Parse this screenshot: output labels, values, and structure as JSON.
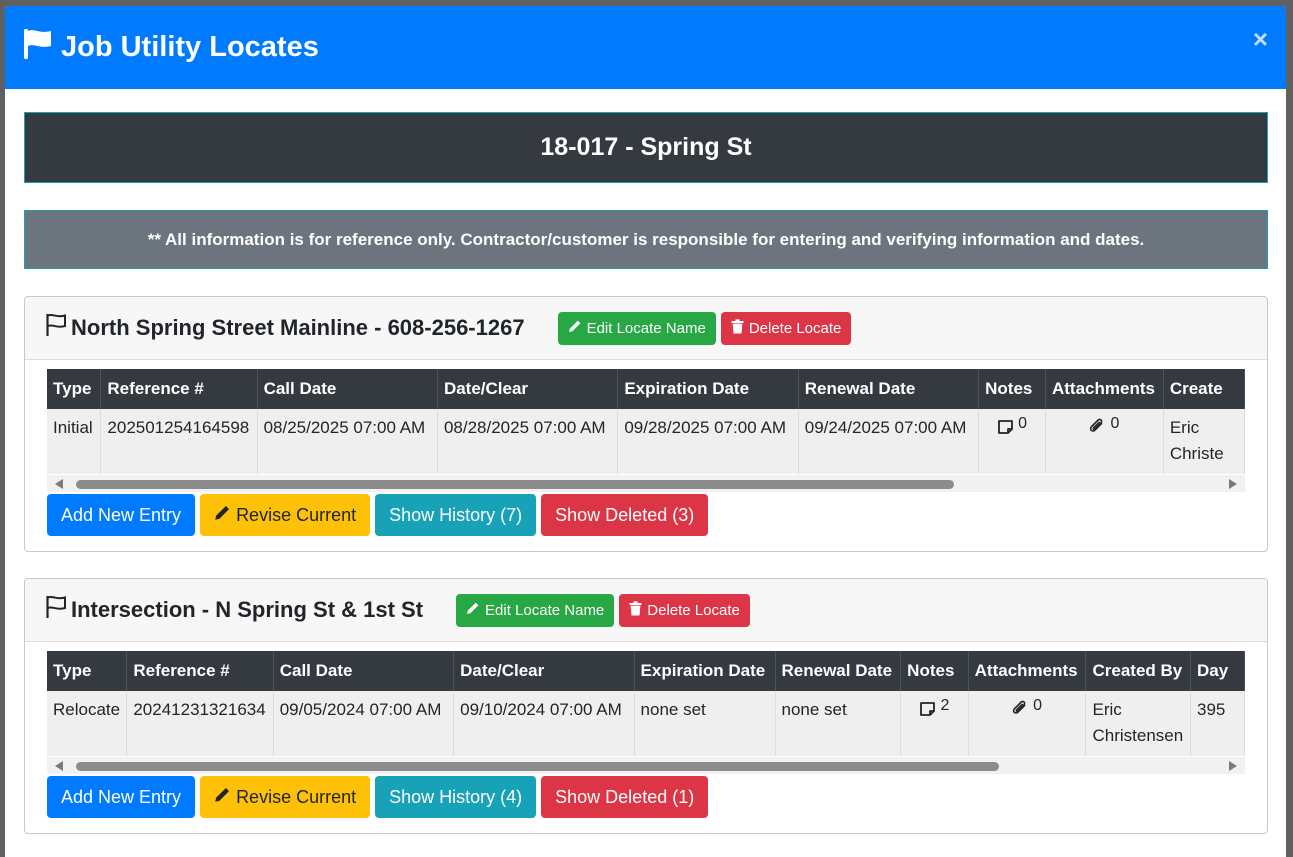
{
  "modal": {
    "title": "Job Utility Locates",
    "close_label": "×"
  },
  "job": {
    "banner": "18-017 - Spring St",
    "notice": "** All information is for reference only. Contractor/customer is responsible for entering and verifying information and dates."
  },
  "locates": [
    {
      "name": "North Spring Street Mainline - 608-256-1267",
      "edit_label": "Edit Locate Name",
      "delete_label": "Delete Locate",
      "headers": [
        "Type",
        "Reference #",
        "Call Date",
        "Date/Clear",
        "Expiration Date",
        "Renewal Date",
        "Notes",
        "Attachments",
        "Create"
      ],
      "row": {
        "type": "Initial",
        "reference": "202501254164598",
        "call_date": "08/25/2025 07:00 AM",
        "date_clear": "08/28/2025 07:00 AM",
        "expiration": "09/28/2025 07:00 AM",
        "renewal": "09/24/2025 07:00 AM",
        "notes_count": "0",
        "attachments_count": "0",
        "created_by": "Eric Christe"
      },
      "scroll_fraction": 0.77,
      "buttons": {
        "add": "Add New Entry",
        "revise": "Revise Current",
        "history": "Show History (7)",
        "deleted": "Show Deleted (3)"
      }
    },
    {
      "name": "Intersection - N Spring St & 1st St",
      "edit_label": "Edit Locate Name",
      "delete_label": "Delete Locate",
      "headers": [
        "Type",
        "Reference #",
        "Call Date",
        "Date/Clear",
        "Expiration Date",
        "Renewal Date",
        "Notes",
        "Attachments",
        "Created By",
        "Day"
      ],
      "row": {
        "type": "Relocate",
        "reference": "20241231321634",
        "call_date": "09/05/2024 07:00 AM",
        "date_clear": "09/10/2024 07:00 AM",
        "expiration": "none set",
        "renewal": "none set",
        "notes_count": "2",
        "attachments_count": "0",
        "created_by": "Eric Christensen",
        "day": "395"
      },
      "scroll_fraction": 0.81,
      "buttons": {
        "add": "Add New Entry",
        "revise": "Revise Current",
        "history": "Show History (4)",
        "deleted": "Show Deleted (1)"
      }
    }
  ],
  "colors": {
    "header_blue": "#007bff",
    "banner_dark": "#343a40",
    "notice_gray": "#6c757d",
    "success": "#28a745",
    "danger": "#dc3545",
    "warning": "#ffc107",
    "info": "#17a2b8"
  },
  "icons": [
    "flag-icon",
    "flag-outline-icon",
    "pencil-icon",
    "trash-icon",
    "note-icon",
    "paperclip-icon",
    "close-icon"
  ]
}
